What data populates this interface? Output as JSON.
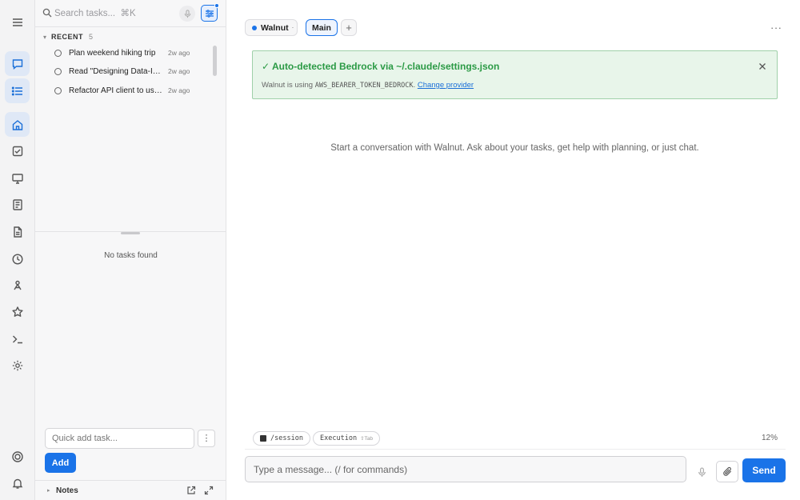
{
  "rail": {
    "items": [
      "menu-icon",
      "chat-icon",
      "list-icon",
      "home-icon",
      "checkbox-icon",
      "monitor-icon",
      "notebook-icon",
      "document-icon",
      "clock-icon",
      "agents-icon",
      "star-icon",
      "terminal-icon",
      "gear-icon",
      "target-icon",
      "bell-icon"
    ],
    "active": [
      "chat-icon",
      "list-icon",
      "home-icon"
    ]
  },
  "search": {
    "placeholder": "Search tasks...  ⌘K"
  },
  "recent": {
    "label": "RECENT",
    "count": "5",
    "items": [
      {
        "title": "Plan weekend hiking trip",
        "time": "2w ago"
      },
      {
        "title": "Read \"Designing Data-Intensive Applications\"",
        "time": "2w ago"
      },
      {
        "title": "Refactor API client to use async/await",
        "time": "2w ago"
      }
    ]
  },
  "tasks": {
    "empty_text": "No tasks found"
  },
  "quick_add": {
    "placeholder": "Quick add task...",
    "more_label": "⋮",
    "add_label": "Add"
  },
  "notes": {
    "label": "Notes"
  },
  "header": {
    "chip_walnut": "Walnut",
    "chip_walnut_sub": "·",
    "chip_main": "Main",
    "chip_plus": "+",
    "more": "···"
  },
  "banner": {
    "title": "✓ Auto-detected Bedrock via ~/.claude/settings.json",
    "text_prefix": "Walnut is using ",
    "env_var": "AWS_BEARER_TOKEN_BEDROCK",
    "text_suffix": ". ",
    "link": "Change provider"
  },
  "chat": {
    "empty_text": "Start a conversation with Walnut. Ask about your tasks, get help with planning, or just chat."
  },
  "status": {
    "session": "/session",
    "execution": "Execution",
    "execution_hint": "⇧Tab",
    "percent": "12%"
  },
  "composer": {
    "placeholder": "Type a message... (/ for commands)",
    "send_label": "Send"
  },
  "colors": {
    "accent": "#1a73e8",
    "success_bg": "#e8f5ea",
    "success_text": "#2b9a45"
  }
}
